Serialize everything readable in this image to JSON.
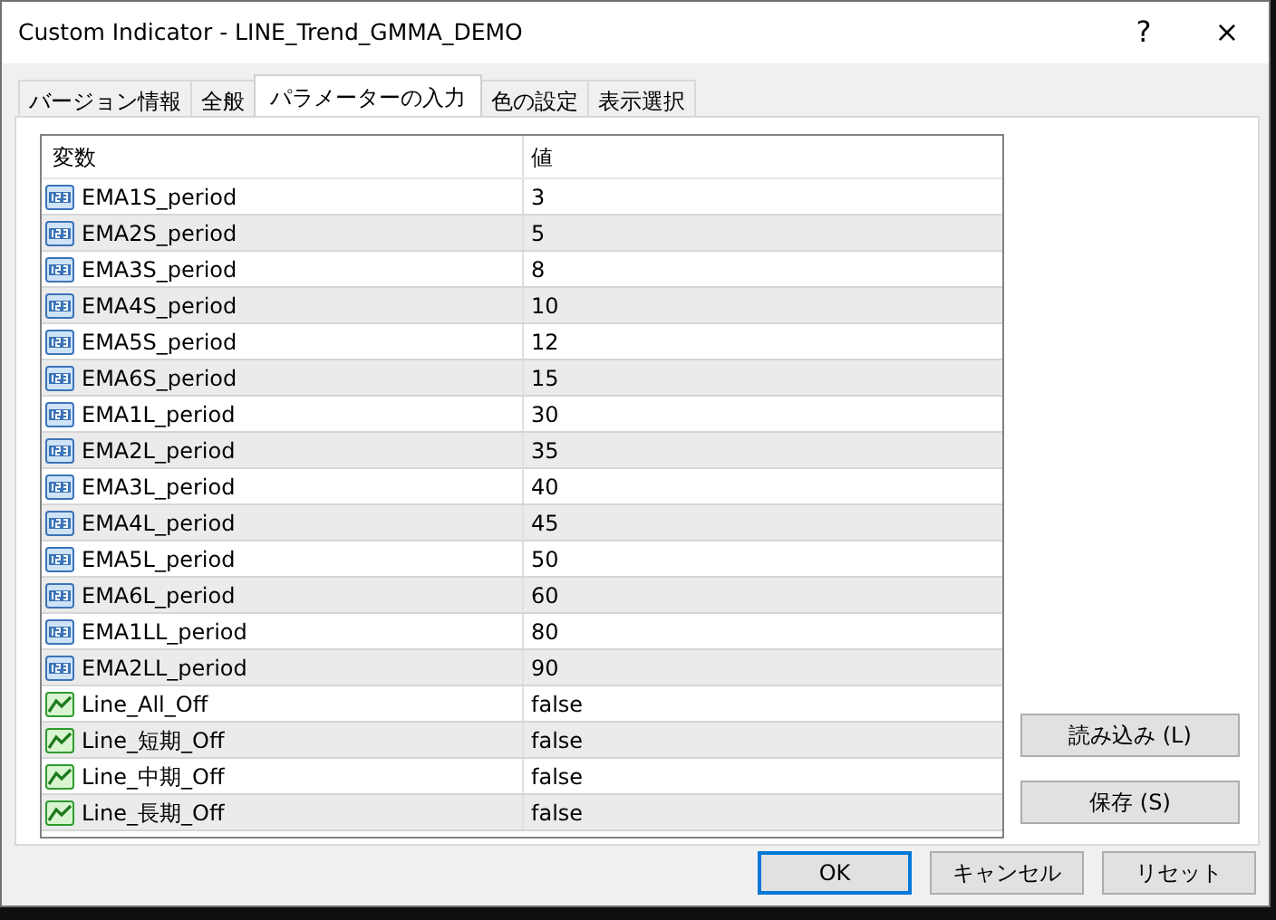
{
  "window": {
    "title": "Custom Indicator - LINE_Trend_GMMA_DEMO",
    "help": "?",
    "close": "×"
  },
  "tabs": [
    {
      "label": "バージョン情報",
      "selected": false
    },
    {
      "label": "全般",
      "selected": false
    },
    {
      "label": "パラメーターの入力",
      "selected": true
    },
    {
      "label": "色の設定",
      "selected": false
    },
    {
      "label": "表示選択",
      "selected": false
    }
  ],
  "table": {
    "columns": [
      "変数",
      "値"
    ],
    "rows": [
      {
        "kind": "number",
        "name": "EMA1S_period",
        "value": "3"
      },
      {
        "kind": "number",
        "name": "EMA2S_period",
        "value": "5"
      },
      {
        "kind": "number",
        "name": "EMA3S_period",
        "value": "8"
      },
      {
        "kind": "number",
        "name": "EMA4S_period",
        "value": "10"
      },
      {
        "kind": "number",
        "name": "EMA5S_period",
        "value": "12"
      },
      {
        "kind": "number",
        "name": "EMA6S_period",
        "value": "15"
      },
      {
        "kind": "number",
        "name": "EMA1L_period",
        "value": "30"
      },
      {
        "kind": "number",
        "name": "EMA2L_period",
        "value": "35"
      },
      {
        "kind": "number",
        "name": "EMA3L_period",
        "value": "40"
      },
      {
        "kind": "number",
        "name": "EMA4L_period",
        "value": "45"
      },
      {
        "kind": "number",
        "name": "EMA5L_period",
        "value": "50"
      },
      {
        "kind": "number",
        "name": "EMA6L_period",
        "value": "60"
      },
      {
        "kind": "number",
        "name": "EMA1LL_period",
        "value": "80"
      },
      {
        "kind": "number",
        "name": "EMA2LL_period",
        "value": "90"
      },
      {
        "kind": "boolean",
        "name": "Line_All_Off",
        "value": "false"
      },
      {
        "kind": "boolean",
        "name": "Line_短期_Off",
        "value": "false"
      },
      {
        "kind": "boolean",
        "name": "Line_中期_Off",
        "value": "false"
      },
      {
        "kind": "boolean",
        "name": "Line_長期_Off",
        "value": "false"
      }
    ]
  },
  "side_buttons": [
    "読み込み (L)",
    "保存 (S)"
  ],
  "buttons": [
    {
      "label": "OK",
      "default": true
    },
    {
      "label": "キャンセル",
      "default": false
    },
    {
      "label": "リセット",
      "default": false
    }
  ]
}
